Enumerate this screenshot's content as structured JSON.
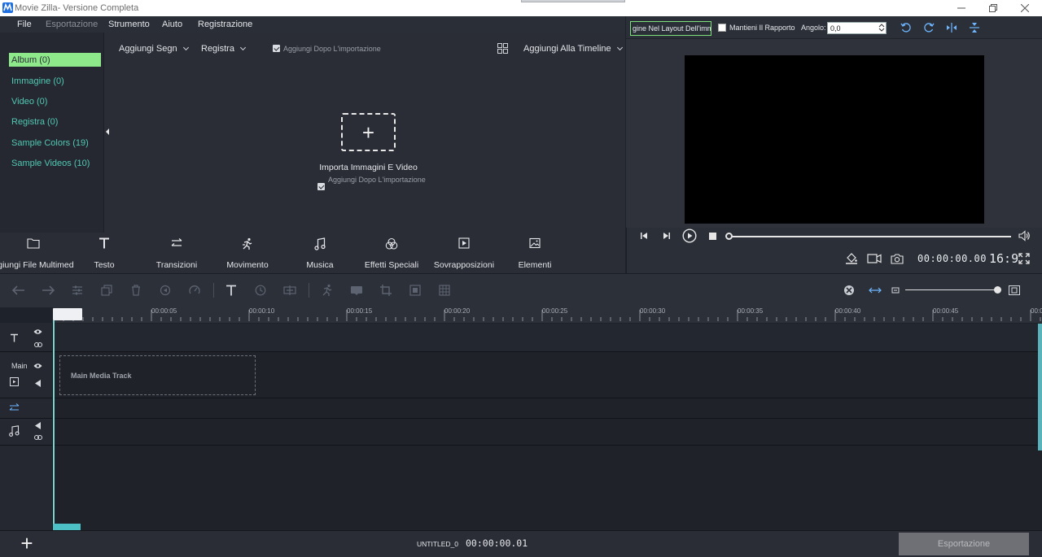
{
  "window": {
    "title": "Movie Zilla- Versione Completa",
    "controls": [
      "minimize",
      "restore",
      "close"
    ]
  },
  "menu": {
    "items": [
      "File",
      "Esportazione",
      "Strumento",
      "Aiuto",
      "Registrazione"
    ],
    "disabled": [
      "Esportazione"
    ]
  },
  "library": {
    "sidebar": [
      {
        "label": "Album (0)",
        "active": true
      },
      {
        "label": "Immagine (0)"
      },
      {
        "label": "Video (0)"
      },
      {
        "label": "Registra (0)"
      },
      {
        "label": "Sample Colors (19)"
      },
      {
        "label": "Sample Videos (10)"
      }
    ],
    "toolbar": {
      "add_mark_label": "Aggiungi Segn",
      "record_label": "Registra",
      "add_after_import_label": "Aggiungi Dopo L'importazione",
      "add_to_timeline_label": "Aggiungi Alla Timeline"
    },
    "import": {
      "title": "Importa Immagini E Video",
      "checkbox_label": "Aggiungi Dopo L'importazione"
    }
  },
  "tool_tabs": [
    {
      "label": "ggiungi File Multimed",
      "icon": "folder-icon"
    },
    {
      "label": "Testo",
      "icon": "text-icon"
    },
    {
      "label": "Transizioni",
      "icon": "transition-icon"
    },
    {
      "label": "Movimento",
      "icon": "motion-icon"
    },
    {
      "label": "Musica",
      "icon": "music-icon"
    },
    {
      "label": "Effetti Speciali",
      "icon": "effects-icon"
    },
    {
      "label": "Sovrapposizioni",
      "icon": "overlay-icon"
    },
    {
      "label": "Elementi",
      "icon": "image-icon"
    }
  ],
  "preview": {
    "layout_button_label": "gine Nel Layout Dell'imm",
    "keep_ratio_label": "Mantieni Il Rapporto",
    "angle_label": "Angolo:",
    "angle_value": "0,0",
    "time": "00:00:00.00",
    "aspect_ratio": "16:9",
    "progress": 0
  },
  "timeline": {
    "ruler_ticks": [
      "00:00:05",
      "00:00:10",
      "00:00:15",
      "00:00:20",
      "00:00:25",
      "00:00:30",
      "00:00:35",
      "00:00:40",
      "00:00:45",
      "00:0"
    ],
    "main_track_label": "Main",
    "main_media_label": "Main Media Track",
    "zoom": 1
  },
  "bottom": {
    "project_name": "UNTITLED_0",
    "project_time": "00:00:00.01",
    "export_label": "Esportazione"
  },
  "colors": {
    "accent_green": "#8ee98a",
    "teal_text": "#50c8b4",
    "playhead": "#7ad3cf",
    "panel_bg": "#2a2d36"
  }
}
